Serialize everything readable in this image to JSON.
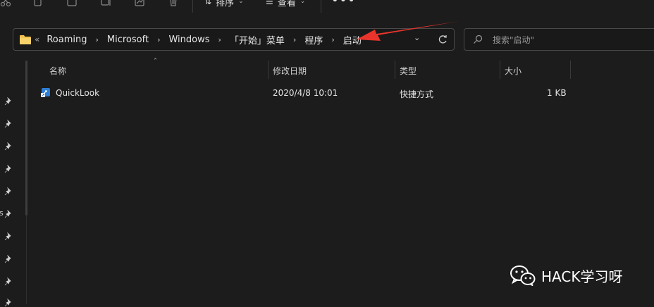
{
  "toolbar": {
    "sort_label": "排序",
    "view_label": "查看",
    "more_label": "•••",
    "chevron": "⌄"
  },
  "address_bar": {
    "overflow": "«",
    "crumbs": [
      "Roaming",
      "Microsoft",
      "Windows",
      "「开始」菜单",
      "程序",
      "启动"
    ],
    "separator": "›"
  },
  "search": {
    "placeholder": "搜索\"启动\""
  },
  "nav_pane": {
    "fragment": "s"
  },
  "columns": {
    "name": "名称",
    "date_modified": "修改日期",
    "type": "类型",
    "size": "大小"
  },
  "files": [
    {
      "name": "QuickLook",
      "date_modified": "2020/4/8 10:01",
      "type": "快捷方式",
      "size": "1 KB"
    }
  ],
  "watermark": {
    "text": "HACK学习呀"
  },
  "colors": {
    "background": "#1c1c1c",
    "annotation_arrow": "#e8342c",
    "folder": "#f2c14e"
  },
  "icons": {
    "toolbar": [
      "cut-icon",
      "copy-icon",
      "paste-icon",
      "rename-icon",
      "share-icon",
      "delete-icon",
      "sort-icon",
      "view-icon"
    ],
    "address": [
      "folder-icon",
      "chevron-down-icon",
      "refresh-icon"
    ],
    "search": "search-icon",
    "file": "shortcut-icon",
    "nav": "pin-icon"
  }
}
